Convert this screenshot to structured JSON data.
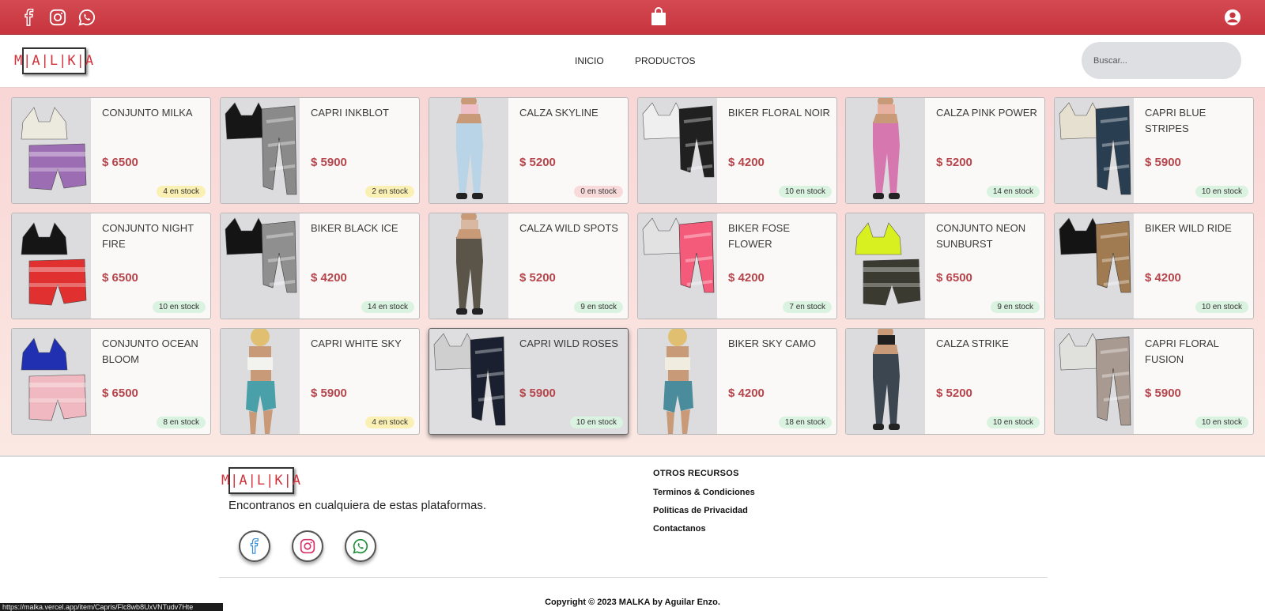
{
  "colors": {
    "topbar": "#c7343d",
    "accent": "#d2323c",
    "price": "#b5454b",
    "stock_ok": "#daf2e0",
    "stock_low": "#fbf0b4",
    "stock_out": "#f8dada"
  },
  "topbar": {
    "left_icons": [
      "facebook-icon",
      "instagram-icon",
      "whatsapp-icon"
    ],
    "center_icon": "shopping-bag-icon",
    "right_icon": "user-account-icon"
  },
  "header": {
    "logo": "M|A|L|K|A",
    "nav": [
      "INICIO",
      "PRODUCTOS"
    ],
    "search_placeholder": "Buscar..."
  },
  "products": [
    {
      "name": "CONJUNTO MILKA",
      "price": "$ 6500",
      "stock": "4 en stock",
      "level": "low",
      "kind": "set",
      "top": "#ece9df",
      "bottom": "#9d6db4"
    },
    {
      "name": "CAPRI INKBLOT",
      "price": "$ 5900",
      "stock": "2 en stock",
      "level": "low",
      "kind": "capri",
      "top": "#161616",
      "bottom": "#8a8a8a"
    },
    {
      "name": "CALZA SKYLINE",
      "price": "$ 5200",
      "stock": "0 en stock",
      "level": "out",
      "kind": "model-legging",
      "top": "#f0c0c8",
      "bottom": "#b8d4e6"
    },
    {
      "name": "BIKER FLORAL NOIR",
      "price": "$ 4200",
      "stock": "10 en stock",
      "level": "ok",
      "kind": "biker",
      "top": "#efefef",
      "bottom": "#202020"
    },
    {
      "name": "CALZA PINK POWER",
      "price": "$ 5200",
      "stock": "14 en stock",
      "level": "ok",
      "kind": "model-legging",
      "top": "#e8b0a0",
      "bottom": "#d777b0"
    },
    {
      "name": "CAPRI BLUE STRIPES",
      "price": "$ 5900",
      "stock": "10 en stock",
      "level": "ok",
      "kind": "capri",
      "top": "#e6e0d0",
      "bottom": "#2a3e52"
    },
    {
      "name": "CONJUNTO NIGHT FIRE",
      "price": "$ 6500",
      "stock": "10 en stock",
      "level": "ok",
      "kind": "set",
      "top": "#151515",
      "bottom": "#e03030"
    },
    {
      "name": "BIKER BLACK ICE",
      "price": "$ 4200",
      "stock": "14 en stock",
      "level": "ok",
      "kind": "biker",
      "top": "#141414",
      "bottom": "#8f8f8f"
    },
    {
      "name": "CALZA WILD SPOTS",
      "price": "$ 5200",
      "stock": "9 en stock",
      "level": "ok",
      "kind": "model-legging",
      "top": "#d8b8a0",
      "bottom": "#5a5548"
    },
    {
      "name": "BIKER FOSE FLOWER",
      "price": "$ 4200",
      "stock": "7 en stock",
      "level": "ok",
      "kind": "biker",
      "top": "#e2e2e2",
      "bottom": "#f45a7a"
    },
    {
      "name": "CONJUNTO NEON SUNBURST",
      "price": "$ 6500",
      "stock": "9 en stock",
      "level": "ok",
      "kind": "set",
      "top": "#d8f020",
      "bottom": "#3a3a30"
    },
    {
      "name": "BIKER WILD RIDE",
      "price": "$ 4200",
      "stock": "10 en stock",
      "level": "ok",
      "kind": "biker",
      "top": "#141414",
      "bottom": "#a07a50"
    },
    {
      "name": "CONJUNTO OCEAN BLOOM",
      "price": "$ 6500",
      "stock": "8 en stock",
      "level": "ok",
      "kind": "set",
      "top": "#2030b0",
      "bottom": "#f0b8c0"
    },
    {
      "name": "CAPRI WHITE SKY",
      "price": "$ 5900",
      "stock": "4 en stock",
      "level": "low",
      "kind": "model-biker",
      "top": "#f2f2ee",
      "bottom": "#4aa0a8"
    },
    {
      "name": "CAPRI WILD ROSES",
      "price": "$ 5900",
      "stock": "10 en stock",
      "level": "ok",
      "kind": "capri",
      "top": "#cfcfcf",
      "bottom": "#1a2030",
      "hover": true
    },
    {
      "name": "BIKER SKY CAMO",
      "price": "$ 4200",
      "stock": "18 en stock",
      "level": "ok",
      "kind": "model-biker",
      "top": "#f0ece0",
      "bottom": "#4a8c9c"
    },
    {
      "name": "CALZA STRIKE",
      "price": "$ 5200",
      "stock": "10 en stock",
      "level": "ok",
      "kind": "model-legging",
      "top": "#202020",
      "bottom": "#3c4650"
    },
    {
      "name": "CAPRI FLORAL FUSION",
      "price": "$ 5900",
      "stock": "10 en stock",
      "level": "ok",
      "kind": "capri",
      "top": "#e0e0dc",
      "bottom": "#a89a90"
    }
  ],
  "footer": {
    "logo": "M|A|L|K|A",
    "tagline": "Encontranos en cualquiera de estas plataformas.",
    "socials": [
      "facebook-icon",
      "instagram-icon",
      "whatsapp-icon"
    ],
    "resources_title": "OTROS RECURSOS",
    "links": [
      "Terminos & Condiciones",
      "Politicas de Privacidad",
      "Contactanos"
    ],
    "copyright": "Copyright © 2023 MALKA by Aguilar Enzo."
  },
  "status_url": "https://malka.vercel.app/item/Capris/Flc8wb8UxVNTudv7Hte"
}
